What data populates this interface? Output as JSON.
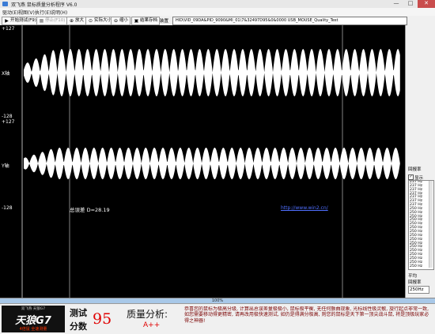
{
  "window": {
    "title": "双飞燕 鼠标质量分析程序 V6.0",
    "controls": {
      "minimize": "—",
      "maximize": "□",
      "close": "✕"
    }
  },
  "menu": [
    "驱动(E)",
    "视图(V)",
    "执行(E)",
    "说明(H)"
  ],
  "toolbar": {
    "start": "开始测试(F9)",
    "stop": "停止(F10)",
    "zoom_in": "放大",
    "actual_size": "实际大小",
    "zoom_out": "缩小",
    "save": "结果存档",
    "device_label": "装置",
    "device_value": "HID\\VID_09DA&PID_9090&MI_01\\7&32497D95&0&0000   USB_MOUSE_Quality_Test"
  },
  "plot": {
    "x_axis_label": "X轴",
    "y_axis_label": "Y轴",
    "x_max": "+127",
    "x_min": "-128",
    "y_max": "+127",
    "y_min": "-128",
    "error_text": "总误差 D=28.19",
    "link_text": "http://www.win2.cn/",
    "colors": {
      "background": "#000000",
      "wave": "#ffffff",
      "link": "#4f6fff"
    }
  },
  "side_panel": {
    "report_rate_title": "回报率",
    "show_checkbox_label": "显示",
    "show_checked": true,
    "rates": [
      "237 Hz",
      "237 Hz",
      "237 Hz",
      "237 Hz",
      "237 Hz",
      "237 Hz",
      "237 Hz",
      "250 Hz",
      "250 Hz",
      "250 Hz",
      "250 Hz",
      "250 Hz",
      "250 Hz",
      "250 Hz",
      "250 Hz",
      "250 Hz",
      "250 Hz",
      "250 Hz",
      "250 Hz",
      "250 Hz",
      "250 Hz",
      "250 Hz",
      "250 Hz"
    ],
    "average_title": "平均",
    "average_sub": "回报率",
    "average_value": "250Hz"
  },
  "progress": {
    "text": "100%",
    "value_percent": 100
  },
  "bottom": {
    "brand_top": "双飞燕 天狼G7",
    "brand_main": "天狼G7",
    "brand_sub": "4倍鼠 全速测量",
    "score_label_1": "测试",
    "score_label_2": "分数",
    "score_value": "95",
    "analysis_title": "质量分析:",
    "grade": "A++",
    "analysis_text": "恭喜您的鼠标为极高分级, 计算出总误差量极极小, 鼠标极平衡, 无任何颤曲现象, 光标线性极灵敏, 旋行起点非常一致, 如您需要移动得更精密, 请再改用极快速测试, 如仍是得满分极高, 则您的鼠标是天下第一顶尖战斗鼠, 将是顶极玩家必得之神器!",
    "brand_colors": {
      "accent": "#ff3300",
      "dark": "#111111"
    }
  }
}
